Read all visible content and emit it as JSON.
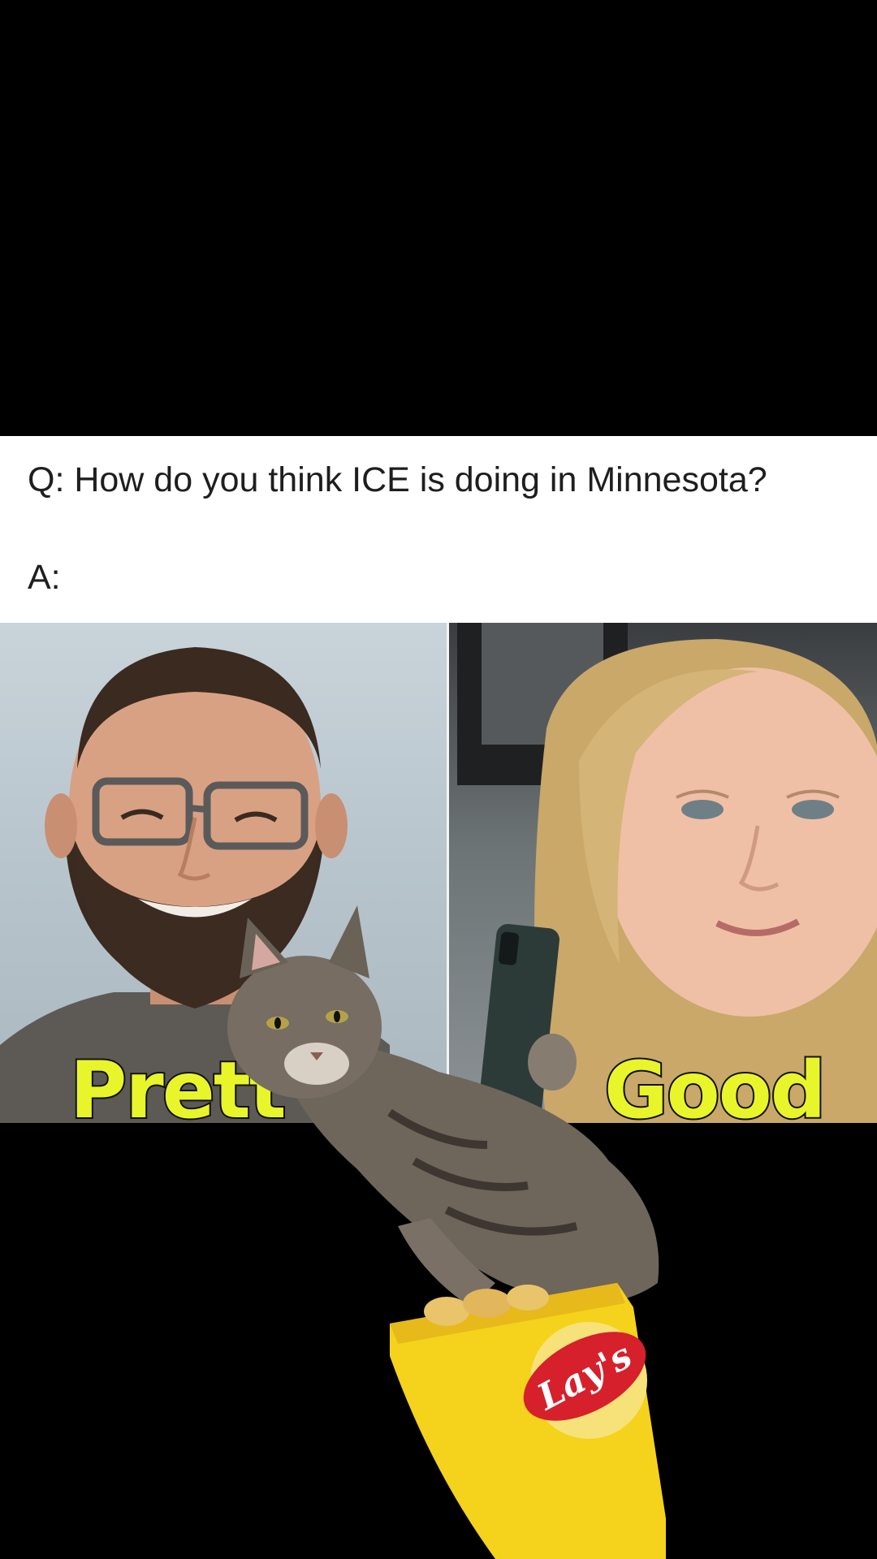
{
  "meme": {
    "question": "Q: How do you think ICE is doing in Minnesota?",
    "answer": "A:",
    "caption_left": "Prett",
    "caption_right": "Good",
    "chip_brand": "Lay's"
  },
  "colors": {
    "caption_fill": "#e8f52a",
    "chip_bag": "#f5d21c",
    "chip_logo_red": "#d6202b"
  }
}
